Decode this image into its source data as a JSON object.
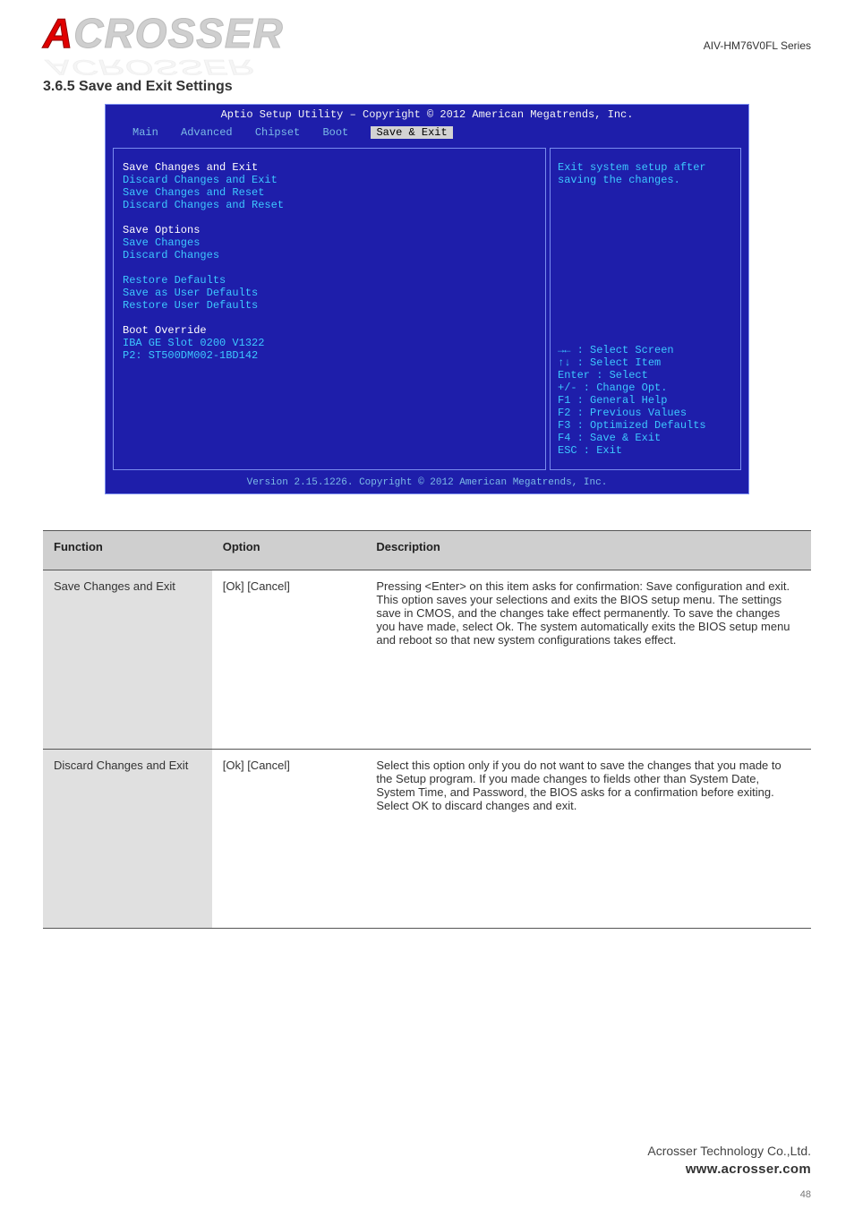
{
  "document": {
    "product_name": "AIV-HM76V0FL Series",
    "section_heading": "3.6.5 Save and Exit Settings",
    "page_number": "48",
    "footer_company": "Acrosser Technology Co.,Ltd.",
    "footer_url": "www.acrosser.com",
    "logo_text": "ACROSSER"
  },
  "bios": {
    "header": "Aptio Setup Utility – Copyright © 2012 American Megatrends,  Inc.",
    "tabs": [
      "Main",
      "Advanced",
      "Chipset",
      "Boot",
      "Save & Exit"
    ],
    "active_tab_index": 4,
    "menu_groups": [
      {
        "items": [
          {
            "label": "Save Changes and Exit",
            "selected": true
          },
          {
            "label": "Discard Changes and Exit"
          },
          {
            "label": "Save Changes and Reset"
          },
          {
            "label": "Discard Changes and Reset"
          }
        ]
      },
      {
        "header": "Save Options",
        "items": [
          {
            "label": "Save Changes"
          },
          {
            "label": "Discard Changes"
          }
        ]
      },
      {
        "items": [
          {
            "label": "Restore Defaults"
          },
          {
            "label": "Save as User Defaults"
          },
          {
            "label": "Restore User Defaults"
          }
        ]
      },
      {
        "header": "Boot Override",
        "items": [
          {
            "label": "IBA GE Slot 0200 V1322"
          },
          {
            "label": "P2: ST500DM002-1BD142"
          }
        ]
      }
    ],
    "help_text": "Exit system setup after saving the changes.",
    "nav_hints": [
      "→← : Select Screen",
      "↑↓ : Select Item",
      "Enter : Select",
      "+/- : Change Opt.",
      "F1 : General Help",
      "F2 : Previous Values",
      "F3 : Optimized Defaults",
      "F4 : Save & Exit",
      "ESC : Exit"
    ],
    "footer": "Version 2.15.1226. Copyright © 2012 American Megatrends, Inc."
  },
  "table": {
    "headers": [
      "Function",
      "Option",
      "Description"
    ],
    "rows": [
      {
        "function": "Save Changes and Exit",
        "option": "[Ok] [Cancel]",
        "description": "Pressing <Enter> on this item asks for confirmation: Save configuration and exit. This option saves your selections and exits the BIOS setup menu. The settings save in CMOS, and the changes take effect permanently. To save the changes you have made, select Ok. The system automatically exits the BIOS setup menu and reboot so that new system configurations takes effect."
      },
      {
        "function": "Discard Changes and Exit",
        "option": "[Ok] [Cancel]",
        "description": "Select this option only if you do not want to save the changes that you made to the Setup program. If you made changes to fields other than System Date, System Time, and Password, the BIOS asks for a confirmation before exiting. Select OK to discard changes and exit."
      }
    ]
  }
}
